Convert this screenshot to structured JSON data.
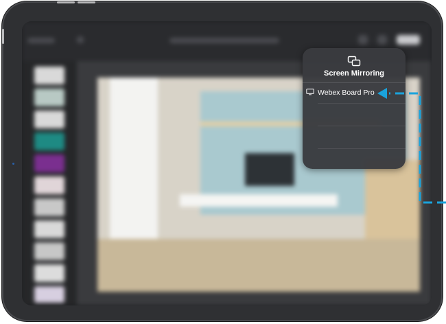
{
  "mirroring": {
    "title": "Screen Mirroring",
    "devices": [
      {
        "label": "Webex Board Pro"
      }
    ]
  },
  "colors": {
    "device_frame": "#2f3033",
    "popover_bg": "#3a3b3f",
    "callout": "#1aa3dc"
  },
  "icons": {
    "mirroring": "screen-mirroring-icon",
    "device": "display-icon"
  }
}
